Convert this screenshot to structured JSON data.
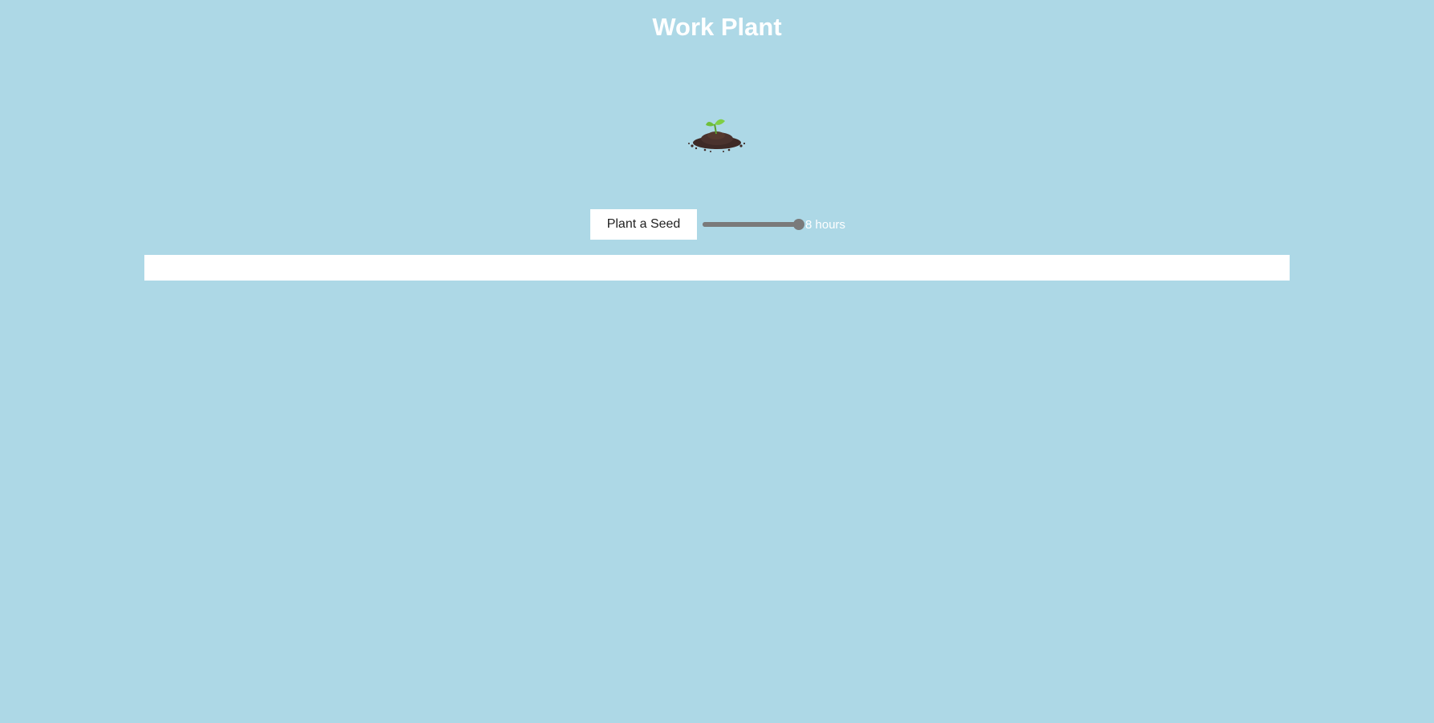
{
  "app": {
    "title": "Work Plant"
  },
  "plant": {
    "icon": "seedling-in-soil-icon",
    "colors": {
      "leaf": "#6fbf3a",
      "soil": "#3e2a26"
    }
  },
  "controls": {
    "plant_button_label": "Plant a Seed",
    "hours_slider": {
      "value": 8,
      "fill_fraction": 1.0
    },
    "hours_label": "8 hours"
  },
  "colors": {
    "background": "#add8e6",
    "panel": "#ffffff",
    "title_text": "#ffffff",
    "slider": "#7a7a7a"
  }
}
